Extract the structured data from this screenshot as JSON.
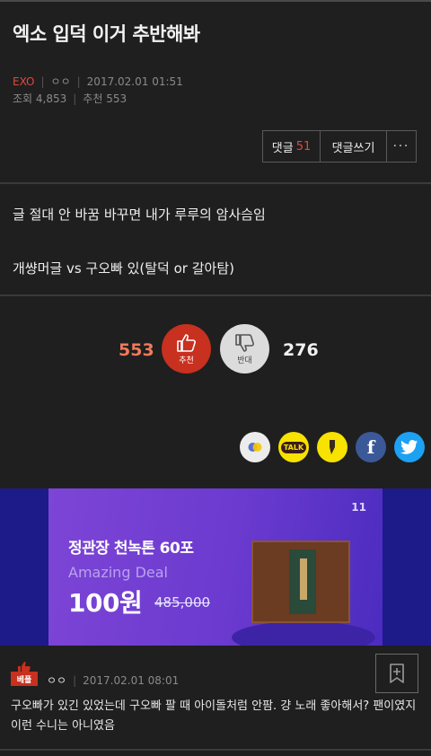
{
  "post": {
    "title": "엑소 입덕 이거 추반해봐",
    "category": "EXO",
    "author": "ㅇㅇ",
    "date": "2017.02.01 01:51",
    "views_label": "조회 4,853",
    "recommend_label": "추천 553"
  },
  "actions": {
    "comments_label": "댓글",
    "comments_count": "51",
    "write_label": "댓글쓰기",
    "more_label": "···"
  },
  "content": {
    "lines": [
      "글 절대 안 바꿈 바꾸면 내가 루루의 암사슴임",
      "개썅머글 vs 구오빠 있(탈덕 or 갈아탐)"
    ]
  },
  "vote": {
    "up_count": "553",
    "up_label": "추천",
    "down_label": "반대",
    "down_count": "276"
  },
  "share": {
    "icons": [
      "kakaostory-icon",
      "kakaotalk-icon",
      "kakao-icon",
      "facebook-icon",
      "twitter-icon"
    ],
    "talk_text": "TALK",
    "facebook_glyph": "f"
  },
  "ad": {
    "brand": "11",
    "product": "정관장 천녹톤 60포",
    "deal": "Amazing Deal",
    "price": "100원",
    "old_price": "485,000"
  },
  "comment": {
    "badge": "베플",
    "author": "ㅇㅇ",
    "date": "2017.02.01 08:01",
    "text": "구오빠가 있긴 있었는데 구오빠 팔 때 아이돌처럼 안팜. 걍 노래 좋아해서? 팬이였지 이런 수니는 아니였음"
  },
  "colors": {
    "background": "#1f1f1f",
    "accent_red": "#c8301f",
    "count_red": "#e2483f",
    "ad_purple": "#7d45d6"
  }
}
